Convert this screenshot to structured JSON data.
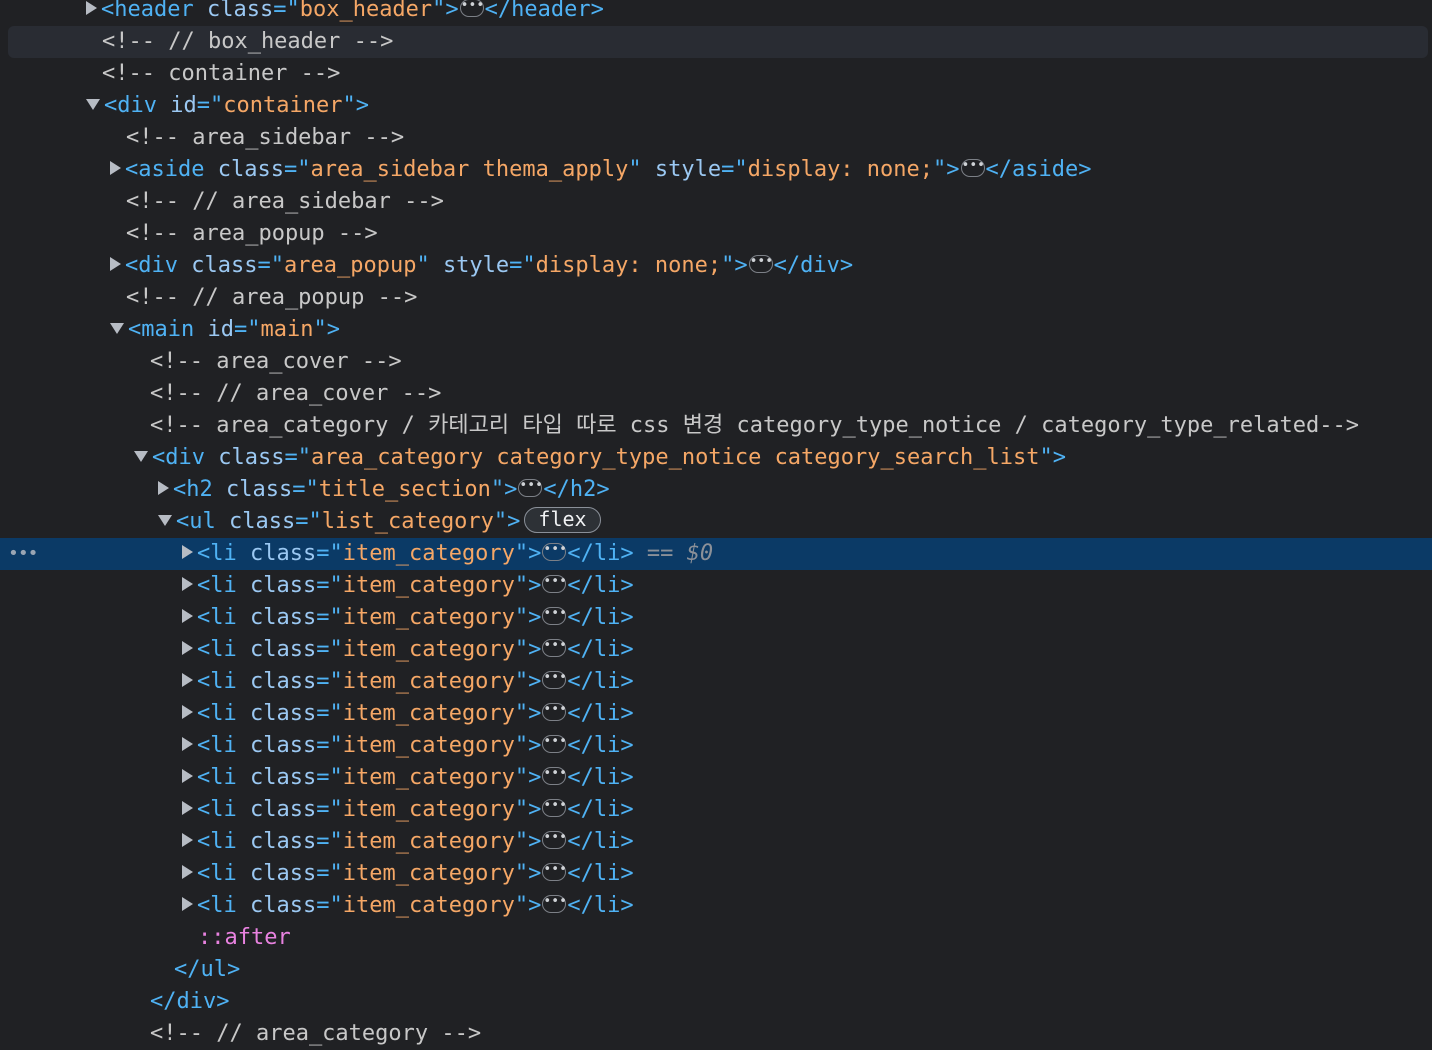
{
  "rows": [
    {
      "indent": 0,
      "triangle": "collapsed",
      "segments": [
        [
          "punct",
          "<"
        ],
        [
          "tag",
          "header"
        ],
        [
          "space",
          " "
        ],
        [
          "attr",
          "class"
        ],
        [
          "punct",
          "=\""
        ],
        [
          "val",
          "box_header"
        ],
        [
          "punct",
          "\">"
        ],
        [
          "ellipsis",
          ""
        ],
        [
          "punct",
          "</"
        ],
        [
          "tag",
          "header"
        ],
        [
          "punct",
          ">"
        ]
      ]
    },
    {
      "indent": 0,
      "triangle": "none",
      "hover": true,
      "segments": [
        [
          "comment",
          "<!-- // box_header -->"
        ]
      ]
    },
    {
      "indent": 0,
      "triangle": "none",
      "segments": [
        [
          "comment",
          "<!-- container -->"
        ]
      ]
    },
    {
      "indent": 0,
      "triangle": "expanded",
      "segments": [
        [
          "punct",
          "<"
        ],
        [
          "tag",
          "div"
        ],
        [
          "space",
          " "
        ],
        [
          "attr",
          "id"
        ],
        [
          "punct",
          "=\""
        ],
        [
          "val",
          "container"
        ],
        [
          "punct",
          "\">"
        ]
      ]
    },
    {
      "indent": 1,
      "triangle": "none",
      "segments": [
        [
          "comment",
          "<!-- area_sidebar -->"
        ]
      ]
    },
    {
      "indent": 1,
      "triangle": "collapsed",
      "segments": [
        [
          "punct",
          "<"
        ],
        [
          "tag",
          "aside"
        ],
        [
          "space",
          " "
        ],
        [
          "attr",
          "class"
        ],
        [
          "punct",
          "=\""
        ],
        [
          "val",
          "area_sidebar thema_apply"
        ],
        [
          "punct",
          "\""
        ],
        [
          "space",
          " "
        ],
        [
          "attr",
          "style"
        ],
        [
          "punct",
          "=\""
        ],
        [
          "val",
          "display: none;"
        ],
        [
          "punct",
          "\">"
        ],
        [
          "ellipsis",
          ""
        ],
        [
          "punct",
          "</"
        ],
        [
          "tag",
          "aside"
        ],
        [
          "punct",
          ">"
        ]
      ]
    },
    {
      "indent": 1,
      "triangle": "none",
      "segments": [
        [
          "comment",
          "<!-- // area_sidebar -->"
        ]
      ]
    },
    {
      "indent": 1,
      "triangle": "none",
      "segments": [
        [
          "comment",
          "<!-- area_popup -->"
        ]
      ]
    },
    {
      "indent": 1,
      "triangle": "collapsed",
      "segments": [
        [
          "punct",
          "<"
        ],
        [
          "tag",
          "div"
        ],
        [
          "space",
          " "
        ],
        [
          "attr",
          "class"
        ],
        [
          "punct",
          "=\""
        ],
        [
          "val",
          "area_popup"
        ],
        [
          "punct",
          "\""
        ],
        [
          "space",
          " "
        ],
        [
          "attr",
          "style"
        ],
        [
          "punct",
          "=\""
        ],
        [
          "val",
          "display: none;"
        ],
        [
          "punct",
          "\">"
        ],
        [
          "ellipsis",
          ""
        ],
        [
          "punct",
          "</"
        ],
        [
          "tag",
          "div"
        ],
        [
          "punct",
          ">"
        ]
      ]
    },
    {
      "indent": 1,
      "triangle": "none",
      "segments": [
        [
          "comment",
          "<!-- // area_popup -->"
        ]
      ]
    },
    {
      "indent": 1,
      "triangle": "expanded",
      "segments": [
        [
          "punct",
          "<"
        ],
        [
          "tag",
          "main"
        ],
        [
          "space",
          " "
        ],
        [
          "attr",
          "id"
        ],
        [
          "punct",
          "=\""
        ],
        [
          "val",
          "main"
        ],
        [
          "punct",
          "\">"
        ]
      ]
    },
    {
      "indent": 2,
      "triangle": "none",
      "segments": [
        [
          "comment",
          "<!-- area_cover -->"
        ]
      ]
    },
    {
      "indent": 2,
      "triangle": "none",
      "segments": [
        [
          "comment",
          "<!-- // area_cover -->"
        ]
      ]
    },
    {
      "indent": 2,
      "triangle": "none",
      "segments": [
        [
          "comment",
          "<!-- area_category / 카테고리 타입 따로 css 변경 category_type_notice / category_type_related-->"
        ]
      ]
    },
    {
      "indent": 2,
      "triangle": "expanded",
      "segments": [
        [
          "punct",
          "<"
        ],
        [
          "tag",
          "div"
        ],
        [
          "space",
          " "
        ],
        [
          "attr",
          "class"
        ],
        [
          "punct",
          "=\""
        ],
        [
          "val",
          "area_category category_type_notice category_search_list"
        ],
        [
          "punct",
          "\">"
        ]
      ]
    },
    {
      "indent": 3,
      "triangle": "collapsed",
      "segments": [
        [
          "punct",
          "<"
        ],
        [
          "tag",
          "h2"
        ],
        [
          "space",
          " "
        ],
        [
          "attr",
          "class"
        ],
        [
          "punct",
          "=\""
        ],
        [
          "val",
          "title_section"
        ],
        [
          "punct",
          "\">"
        ],
        [
          "ellipsis",
          ""
        ],
        [
          "punct",
          "</"
        ],
        [
          "tag",
          "h2"
        ],
        [
          "punct",
          ">"
        ]
      ]
    },
    {
      "indent": 3,
      "triangle": "expanded",
      "segments": [
        [
          "punct",
          "<"
        ],
        [
          "tag",
          "ul"
        ],
        [
          "space",
          " "
        ],
        [
          "attr",
          "class"
        ],
        [
          "punct",
          "=\""
        ],
        [
          "val",
          "list_category"
        ],
        [
          "punct",
          "\">"
        ],
        [
          "badge",
          "flex"
        ]
      ]
    },
    {
      "indent": 4,
      "triangle": "collapsed",
      "selected": true,
      "segments": [
        [
          "punct",
          "<"
        ],
        [
          "tag",
          "li"
        ],
        [
          "space",
          " "
        ],
        [
          "attr",
          "class"
        ],
        [
          "punct",
          "=\""
        ],
        [
          "val",
          "item_category"
        ],
        [
          "punct",
          "\">"
        ],
        [
          "ellipsis",
          ""
        ],
        [
          "punct",
          "</"
        ],
        [
          "tag",
          "li"
        ],
        [
          "punct",
          ">"
        ],
        [
          "space",
          " "
        ],
        [
          "ref",
          "== $0"
        ]
      ]
    },
    {
      "indent": 4,
      "triangle": "collapsed",
      "segments": [
        [
          "punct",
          "<"
        ],
        [
          "tag",
          "li"
        ],
        [
          "space",
          " "
        ],
        [
          "attr",
          "class"
        ],
        [
          "punct",
          "=\""
        ],
        [
          "val",
          "item_category"
        ],
        [
          "punct",
          "\">"
        ],
        [
          "ellipsis",
          ""
        ],
        [
          "punct",
          "</"
        ],
        [
          "tag",
          "li"
        ],
        [
          "punct",
          ">"
        ]
      ]
    },
    {
      "indent": 4,
      "triangle": "collapsed",
      "segments": [
        [
          "punct",
          "<"
        ],
        [
          "tag",
          "li"
        ],
        [
          "space",
          " "
        ],
        [
          "attr",
          "class"
        ],
        [
          "punct",
          "=\""
        ],
        [
          "val",
          "item_category"
        ],
        [
          "punct",
          "\">"
        ],
        [
          "ellipsis",
          ""
        ],
        [
          "punct",
          "</"
        ],
        [
          "tag",
          "li"
        ],
        [
          "punct",
          ">"
        ]
      ]
    },
    {
      "indent": 4,
      "triangle": "collapsed",
      "segments": [
        [
          "punct",
          "<"
        ],
        [
          "tag",
          "li"
        ],
        [
          "space",
          " "
        ],
        [
          "attr",
          "class"
        ],
        [
          "punct",
          "=\""
        ],
        [
          "val",
          "item_category"
        ],
        [
          "punct",
          "\">"
        ],
        [
          "ellipsis",
          ""
        ],
        [
          "punct",
          "</"
        ],
        [
          "tag",
          "li"
        ],
        [
          "punct",
          ">"
        ]
      ]
    },
    {
      "indent": 4,
      "triangle": "collapsed",
      "segments": [
        [
          "punct",
          "<"
        ],
        [
          "tag",
          "li"
        ],
        [
          "space",
          " "
        ],
        [
          "attr",
          "class"
        ],
        [
          "punct",
          "=\""
        ],
        [
          "val",
          "item_category"
        ],
        [
          "punct",
          "\">"
        ],
        [
          "ellipsis",
          ""
        ],
        [
          "punct",
          "</"
        ],
        [
          "tag",
          "li"
        ],
        [
          "punct",
          ">"
        ]
      ]
    },
    {
      "indent": 4,
      "triangle": "collapsed",
      "segments": [
        [
          "punct",
          "<"
        ],
        [
          "tag",
          "li"
        ],
        [
          "space",
          " "
        ],
        [
          "attr",
          "class"
        ],
        [
          "punct",
          "=\""
        ],
        [
          "val",
          "item_category"
        ],
        [
          "punct",
          "\">"
        ],
        [
          "ellipsis",
          ""
        ],
        [
          "punct",
          "</"
        ],
        [
          "tag",
          "li"
        ],
        [
          "punct",
          ">"
        ]
      ]
    },
    {
      "indent": 4,
      "triangle": "collapsed",
      "segments": [
        [
          "punct",
          "<"
        ],
        [
          "tag",
          "li"
        ],
        [
          "space",
          " "
        ],
        [
          "attr",
          "class"
        ],
        [
          "punct",
          "=\""
        ],
        [
          "val",
          "item_category"
        ],
        [
          "punct",
          "\">"
        ],
        [
          "ellipsis",
          ""
        ],
        [
          "punct",
          "</"
        ],
        [
          "tag",
          "li"
        ],
        [
          "punct",
          ">"
        ]
      ]
    },
    {
      "indent": 4,
      "triangle": "collapsed",
      "segments": [
        [
          "punct",
          "<"
        ],
        [
          "tag",
          "li"
        ],
        [
          "space",
          " "
        ],
        [
          "attr",
          "class"
        ],
        [
          "punct",
          "=\""
        ],
        [
          "val",
          "item_category"
        ],
        [
          "punct",
          "\">"
        ],
        [
          "ellipsis",
          ""
        ],
        [
          "punct",
          "</"
        ],
        [
          "tag",
          "li"
        ],
        [
          "punct",
          ">"
        ]
      ]
    },
    {
      "indent": 4,
      "triangle": "collapsed",
      "segments": [
        [
          "punct",
          "<"
        ],
        [
          "tag",
          "li"
        ],
        [
          "space",
          " "
        ],
        [
          "attr",
          "class"
        ],
        [
          "punct",
          "=\""
        ],
        [
          "val",
          "item_category"
        ],
        [
          "punct",
          "\">"
        ],
        [
          "ellipsis",
          ""
        ],
        [
          "punct",
          "</"
        ],
        [
          "tag",
          "li"
        ],
        [
          "punct",
          ">"
        ]
      ]
    },
    {
      "indent": 4,
      "triangle": "collapsed",
      "segments": [
        [
          "punct",
          "<"
        ],
        [
          "tag",
          "li"
        ],
        [
          "space",
          " "
        ],
        [
          "attr",
          "class"
        ],
        [
          "punct",
          "=\""
        ],
        [
          "val",
          "item_category"
        ],
        [
          "punct",
          "\">"
        ],
        [
          "ellipsis",
          ""
        ],
        [
          "punct",
          "</"
        ],
        [
          "tag",
          "li"
        ],
        [
          "punct",
          ">"
        ]
      ]
    },
    {
      "indent": 4,
      "triangle": "collapsed",
      "segments": [
        [
          "punct",
          "<"
        ],
        [
          "tag",
          "li"
        ],
        [
          "space",
          " "
        ],
        [
          "attr",
          "class"
        ],
        [
          "punct",
          "=\""
        ],
        [
          "val",
          "item_category"
        ],
        [
          "punct",
          "\">"
        ],
        [
          "ellipsis",
          ""
        ],
        [
          "punct",
          "</"
        ],
        [
          "tag",
          "li"
        ],
        [
          "punct",
          ">"
        ]
      ]
    },
    {
      "indent": 4,
      "triangle": "collapsed",
      "segments": [
        [
          "punct",
          "<"
        ],
        [
          "tag",
          "li"
        ],
        [
          "space",
          " "
        ],
        [
          "attr",
          "class"
        ],
        [
          "punct",
          "=\""
        ],
        [
          "val",
          "item_category"
        ],
        [
          "punct",
          "\">"
        ],
        [
          "ellipsis",
          ""
        ],
        [
          "punct",
          "</"
        ],
        [
          "tag",
          "li"
        ],
        [
          "punct",
          ">"
        ]
      ]
    },
    {
      "indent": 4,
      "triangle": "none",
      "segments": [
        [
          "pseudo",
          "::after"
        ]
      ]
    },
    {
      "indent": 3,
      "triangle": "none",
      "segments": [
        [
          "punct",
          "</"
        ],
        [
          "tag",
          "ul"
        ],
        [
          "punct",
          ">"
        ]
      ]
    },
    {
      "indent": 2,
      "triangle": "none",
      "segments": [
        [
          "punct",
          "</"
        ],
        [
          "tag",
          "div"
        ],
        [
          "punct",
          ">"
        ]
      ]
    },
    {
      "indent": 2,
      "triangle": "none",
      "segments": [
        [
          "comment",
          "<!-- // area_category -->"
        ]
      ]
    }
  ],
  "selected_row_gutter": "•••",
  "colors": {
    "background": "#202124",
    "selected": "#0b3a66",
    "tag": "#4fb2f4",
    "attribute": "#9bc8f2",
    "value": "#f5a766",
    "comment": "#c8c8c8",
    "pseudo": "#e882e0"
  }
}
